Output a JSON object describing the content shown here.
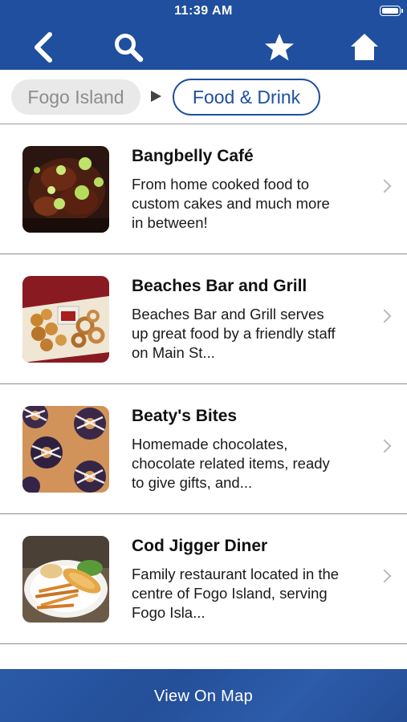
{
  "status_bar": {
    "time": "11:39 AM"
  },
  "nav": {
    "back_icon": "chevron-left-icon",
    "search_icon": "search-icon",
    "favorites_icon": "star-icon",
    "home_icon": "home-icon",
    "color": "#1f4f9e"
  },
  "breadcrumb": {
    "parent": "Fogo Island",
    "current": "Food & Drink"
  },
  "listings": [
    {
      "title": "Bangbelly Café",
      "description": "From home cooked food to custom cakes and much more in between!"
    },
    {
      "title": "Beaches Bar and Grill",
      "description": "Beaches Bar and Grill serves up great food by a friendly staff on Main St..."
    },
    {
      "title": "Beaty's Bites",
      "description": "Homemade chocolates, chocolate related items, ready to give gifts, and..."
    },
    {
      "title": "Cod Jigger Diner",
      "description": "Family restaurant located in the centre of Fogo Island, serving Fogo Isla..."
    }
  ],
  "bottom_bar": {
    "label": "View On Map"
  }
}
